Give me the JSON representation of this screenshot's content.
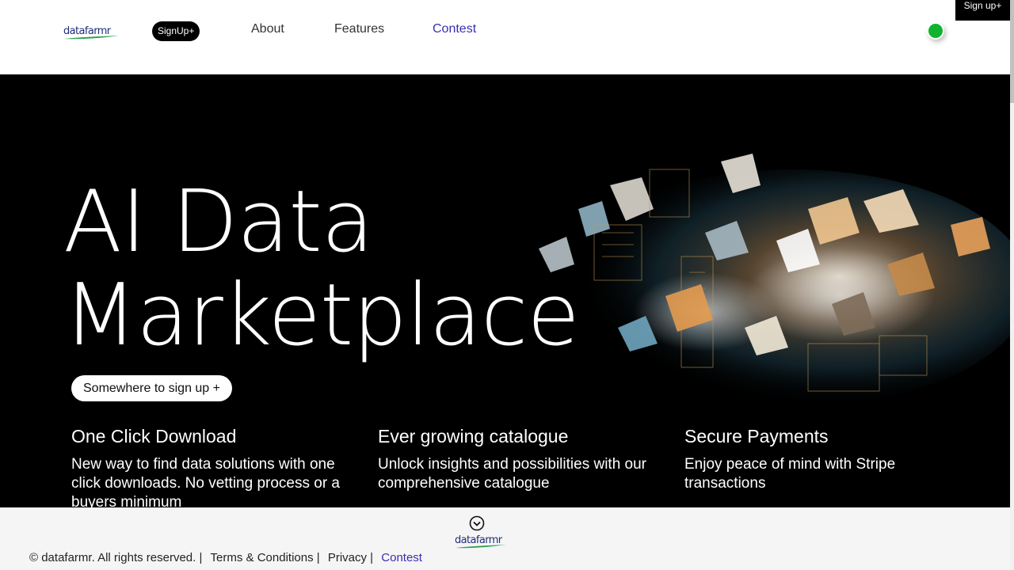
{
  "header": {
    "logo_text": "datafarmr",
    "signup_label": "SignUp+",
    "nav": {
      "about": "About",
      "features": "Features",
      "contest": "Contest"
    },
    "corner_signup": "Sign up+"
  },
  "hero": {
    "title_line1": "AI Data",
    "title_line2": "Marketplace",
    "cta": "Somewhere to sign up +",
    "features": [
      {
        "title": "One Click Download",
        "text": "New way to find data solutions with one click downloads. No vetting process or a buyers minimum"
      },
      {
        "title": "Ever growing catalogue",
        "text": "Unlock insights and possibilities with our comprehensive catalogue"
      },
      {
        "title": "Secure Payments",
        "text": "Enjoy peace of mind with Stripe transactions"
      }
    ]
  },
  "footer": {
    "logo_text": "datafarmr",
    "copyright": "© datafarmr. All rights reserved. |",
    "terms": "Terms & Conditions |",
    "privacy": "Privacy |",
    "contest": "Contest"
  },
  "colors": {
    "brand_blue": "#1f2f7a",
    "brand_green": "#2ea44f",
    "accent_link": "#3a2fb0",
    "status_green": "#10b330"
  },
  "icons": [
    "chevron-down-circle-icon",
    "status-dot-icon"
  ]
}
